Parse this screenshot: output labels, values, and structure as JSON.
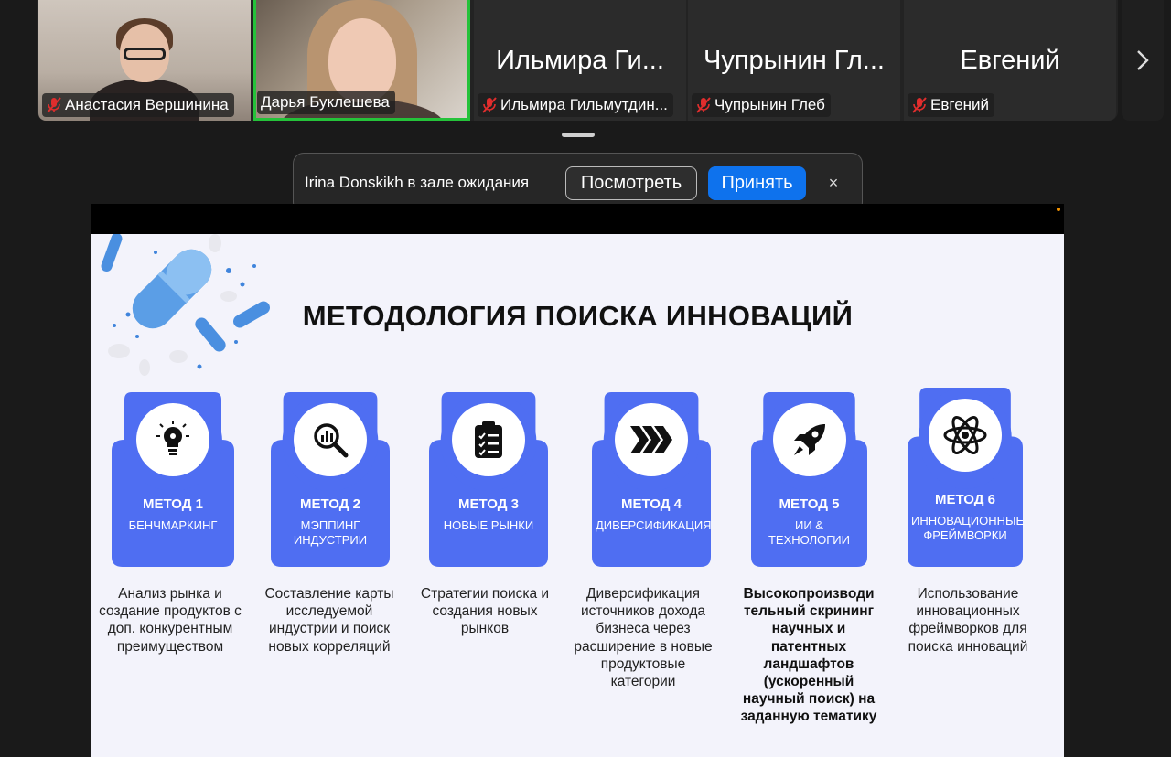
{
  "participants": [
    {
      "name": "Анастасия Вершинина",
      "muted": true
    },
    {
      "name": "Дарья Буклешева",
      "muted": false
    },
    {
      "display": "Ильмира Ги...",
      "name": "Ильмира Гильмутдин...",
      "muted": true
    },
    {
      "display": "Чупрынин Гл...",
      "name": "Чупрынин Глеб",
      "muted": true
    },
    {
      "display": "Евгений",
      "name": "Евгений",
      "muted": true
    }
  ],
  "waiting_room": {
    "message": "Irina Donskikh в зале ожидания",
    "view_label": "Посмотреть",
    "accept_label": "Принять",
    "close_label": "×"
  },
  "slide": {
    "title": "МЕТОДОЛОГИЯ ПОИСКА ИННОВАЦИЙ",
    "accent_color": "#4f6ef2",
    "methods": [
      {
        "label": "МЕТОД 1",
        "sub": "БЕНЧМАРКИНГ",
        "icon": "lightbulb-icon",
        "desc": "Анализ рынка и создание продуктов с доп. конкурентным преимуществом"
      },
      {
        "label": "МЕТОД 2",
        "sub": "МЭППИНГ ИНДУСТРИИ",
        "icon": "chart-search-icon",
        "desc": "Составление карты исследуемой индустрии и поиск новых корреляций"
      },
      {
        "label": "МЕТОД 3",
        "sub": "НОВЫЕ РЫНКИ",
        "icon": "clipboard-icon",
        "desc": "Стратегии поиска и создания новых рынков"
      },
      {
        "label": "МЕТОД 4",
        "sub": "ДИВЕРСИФИКАЦИЯ",
        "icon": "chevrons-icon",
        "desc": "Диверсификация источников дохода бизнеса через расширение в новые продуктовые категории"
      },
      {
        "label": "МЕТОД 5",
        "sub": "ИИ & ТЕХНОЛОГИИ",
        "icon": "rocket-icon",
        "desc": "Высокопроизводи тельный скрининг научных и патентных ландшафтов (ускоренный научный поиск) на заданную тематику"
      },
      {
        "label": "МЕТОД 6",
        "sub": "ИННОВАЦИОННЫЕ ФРЕЙМВОРКИ",
        "icon": "atom-icon",
        "desc": "Использование инновационных фреймворков для поиска инноваций"
      }
    ]
  }
}
